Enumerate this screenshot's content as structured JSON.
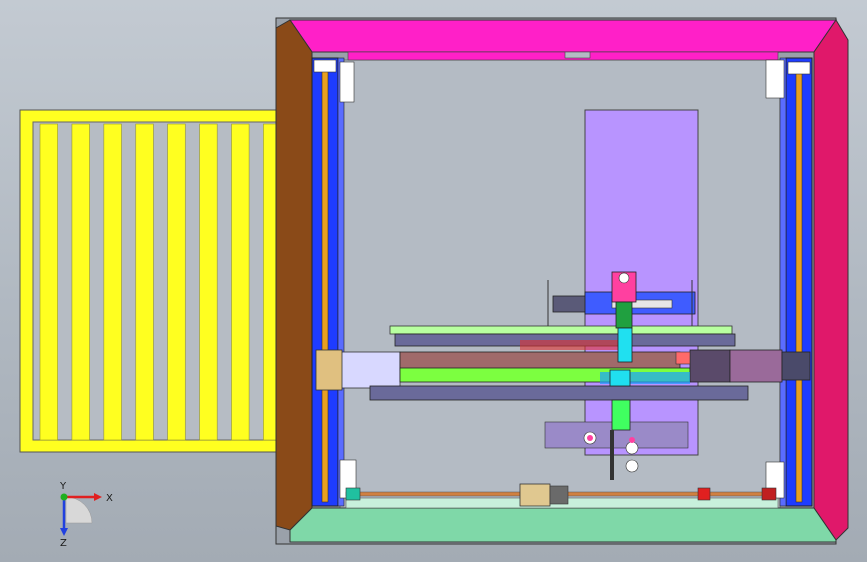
{
  "viewport": {
    "background_top": "#c3cad2",
    "background_bottom": "#a3abb4"
  },
  "triad": {
    "x_label": "X",
    "y_label": "Y",
    "z_label": "Z",
    "x_color": "#e02020",
    "y_color": "#20b020",
    "z_color": "#2040e0"
  },
  "model": {
    "frame_top_color": "#ff20c8",
    "frame_right_color": "#e0186a",
    "frame_left_color": "#8a4a18",
    "frame_bottom_color": "#7fd8a8",
    "rail_color": "#1e3cff",
    "rail_stripe_color": "#e8a020",
    "pallet_color": "#ffff20",
    "panel_color": "#b894ff",
    "beam_color": "#a06a6a",
    "beam_green": "#7cff40",
    "gripper_color": "#1aa0ff",
    "shaft_color": "#d08040",
    "motor_color": "#e0c890"
  }
}
